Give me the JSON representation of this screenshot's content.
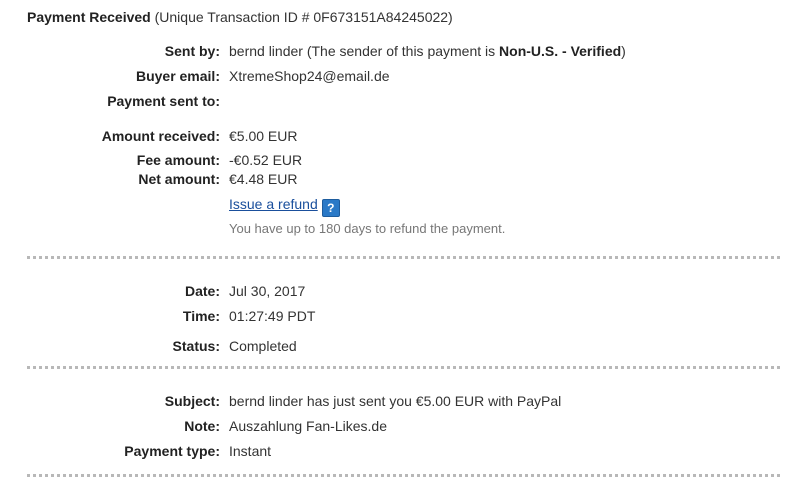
{
  "header": {
    "title": "Payment Received",
    "transaction": "(Unique Transaction ID # 0F673151A84245022)"
  },
  "sender": {
    "label": "Sent by:",
    "name": "bernd linder",
    "status_prefix": " (The sender of this payment is ",
    "status": "Non-U.S. - Verified",
    "status_suffix": ")"
  },
  "buyer_email": {
    "label": "Buyer email:",
    "value": "XtremeShop24@email.de"
  },
  "payment_sent_to": {
    "label": "Payment sent to:",
    "value": ""
  },
  "amount_received": {
    "label": "Amount received:",
    "value": "€5.00 EUR"
  },
  "fee_amount": {
    "label": "Fee amount:",
    "value": "-€0.52 EUR"
  },
  "net_amount": {
    "label": "Net amount:",
    "value": "€4.48 EUR"
  },
  "refund": {
    "link": "Issue a refund",
    "help_glyph": "?",
    "help_icon": "help-question-icon",
    "note": "You have up to 180 days to refund the payment."
  },
  "date": {
    "label": "Date:",
    "value": "Jul 30, 2017"
  },
  "time": {
    "label": "Time:",
    "value": "01:27:49 PDT"
  },
  "status": {
    "label": "Status:",
    "value": "Completed"
  },
  "subject": {
    "label": "Subject:",
    "value": "bernd linder has just sent you €5.00 EUR with PayPal"
  },
  "note": {
    "label": "Note:",
    "value": "Auszahlung Fan-Likes.de"
  },
  "payment_type": {
    "label": "Payment type:",
    "value": "Instant"
  },
  "colors": {
    "link": "#1a4f9c",
    "help_icon": "#2a79c7",
    "divider": "#b8b8b8"
  }
}
